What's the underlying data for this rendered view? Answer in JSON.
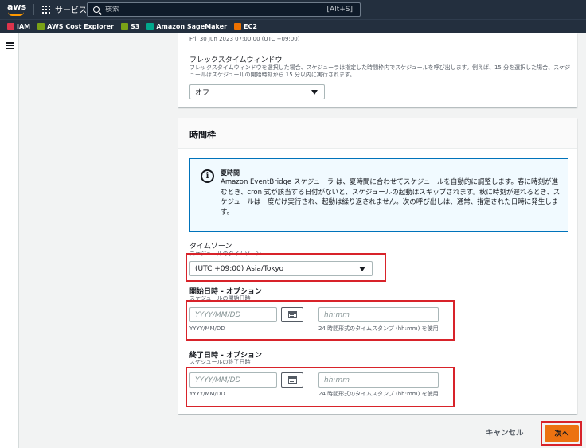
{
  "topnav": {
    "logo_text": "aws",
    "services_label": "サービス",
    "search_placeholder": "検索",
    "search_shortcut": "[Alt+S]"
  },
  "favorites": [
    {
      "label": "IAM",
      "color": "#dd344c"
    },
    {
      "label": "AWS Cost Explorer",
      "color": "#7aa116"
    },
    {
      "label": "S3",
      "color": "#7aa116"
    },
    {
      "label": "Amazon SageMaker",
      "color": "#01a88d"
    },
    {
      "label": "EC2",
      "color": "#ed7100"
    }
  ],
  "schedule_panel": {
    "date_hint": "Fri, 30 Jun 2023 07:00:00 (UTC +09:00)",
    "flex_title": "フレックスタイムウィンドウ",
    "flex_desc": "フレックスタイムウィンドウを選択した場合、スケジューラは指定した時間枠内でスケジュールを呼び出します。例えば、15 分を選択した場合、スケジュールはスケジュールの開始時刻から 15 分以内に実行されます。",
    "flex_value": "オフ"
  },
  "timeframe_panel": {
    "title": "時間枠",
    "info_title": "夏時間",
    "info_text": "Amazon EventBridge スケジューラ は、夏時間に合わせてスケジュールを自動的に調整します。春に時刻が進むとき、cron 式が該当する日付がないと、スケジュールの起動はスキップされます。秋に時刻が遅れるとき、スケジュールは一度だけ実行され、起動は繰り返されません。次の呼び出しは、通常、指定された日時に発生します。",
    "timezone": {
      "label": "タイムゾーン",
      "desc": "スケジュールのタイムゾーン",
      "value": "(UTC +09:00) Asia/Tokyo"
    },
    "start": {
      "label": "開始日時 - オプション",
      "desc": "スケジュールの開始日時",
      "date_placeholder": "YYYY/MM/DD",
      "time_placeholder": "hh:mm",
      "date_hint": "YYYY/MM/DD",
      "time_hint": "24 時間形式のタイムスタンプ (hh:mm) を使用"
    },
    "end": {
      "label": "終了日時 - オプション",
      "desc": "スケジュールの終了日時",
      "date_placeholder": "YYYY/MM/DD",
      "time_placeholder": "hh:mm",
      "date_hint": "YYYY/MM/DD",
      "time_hint": "24 時間形式のタイムスタンプ (hh:mm) を使用"
    }
  },
  "footer": {
    "cancel_label": "キャンセル",
    "next_label": "次へ"
  },
  "colors": {
    "nav_bg": "#232f3e",
    "primary_button": "#ec7211",
    "highlight": "#d8232a",
    "info_border": "#0073bb"
  }
}
